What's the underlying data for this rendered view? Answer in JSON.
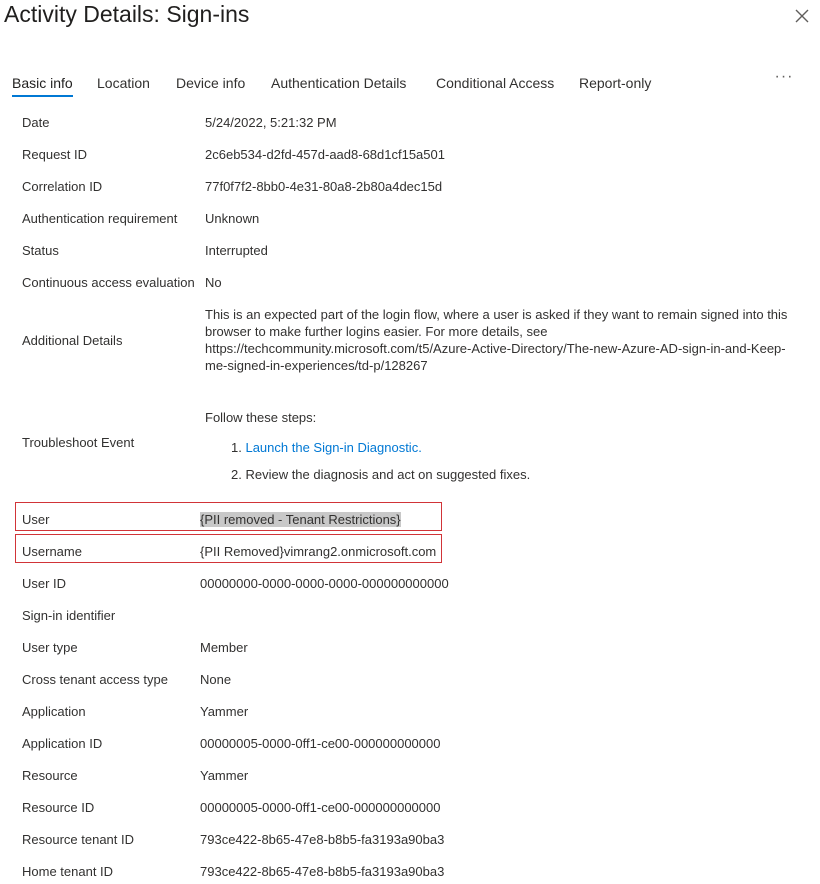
{
  "header": {
    "title": "Activity Details: Sign-ins"
  },
  "tabs": [
    {
      "label": "Basic info"
    },
    {
      "label": "Location"
    },
    {
      "label": "Device info"
    },
    {
      "label": "Authentication Details"
    },
    {
      "label": "Conditional Access"
    },
    {
      "label": "Report-only"
    }
  ],
  "more_label": "···",
  "details": {
    "date": {
      "label": "Date",
      "value": "5/24/2022, 5:21:32 PM"
    },
    "request_id": {
      "label": "Request ID",
      "value": "2c6eb534-d2fd-457d-aad8-68d1cf15a501"
    },
    "correlation_id": {
      "label": "Correlation ID",
      "value": "77f0f7f2-8bb0-4e31-80a8-2b80a4dec15d"
    },
    "auth_requirement": {
      "label": "Authentication requirement",
      "value": "Unknown"
    },
    "status": {
      "label": "Status",
      "value": "Interrupted"
    },
    "cae": {
      "label": "Continuous access evaluation",
      "value": "No"
    },
    "additional_details": {
      "label": "Additional Details",
      "value": "This is an expected part of the login flow, where a user is asked if they want to remain signed into this browser to make further logins easier. For more details, see https://techcommunity.microsoft.com/t5/Azure-Active-Directory/The-new-Azure-AD-sign-in-and-Keep-me-signed-in-experiences/td-p/128267"
    },
    "troubleshoot": {
      "label": "Troubleshoot Event",
      "intro": "Follow these steps:",
      "step1_num": "1.",
      "step1_link": "Launch the Sign-in Diagnostic.",
      "step2": "2. Review the diagnosis and act on suggested fixes."
    },
    "user": {
      "label": "User",
      "value": "{PII removed - Tenant Restrictions}"
    },
    "username": {
      "label": "Username",
      "value": "{PII Removed}vimrang2.onmicrosoft.com"
    },
    "user_id": {
      "label": "User ID",
      "value": "00000000-0000-0000-0000-000000000000"
    },
    "signin_identifier": {
      "label": "Sign-in identifier",
      "value": ""
    },
    "user_type": {
      "label": "User type",
      "value": "Member"
    },
    "cross_tenant": {
      "label": "Cross tenant access type",
      "value": "None"
    },
    "application": {
      "label": "Application",
      "value": "Yammer"
    },
    "application_id": {
      "label": "Application ID",
      "value": "00000005-0000-0ff1-ce00-000000000000"
    },
    "resource": {
      "label": "Resource",
      "value": "Yammer"
    },
    "resource_id": {
      "label": "Resource ID",
      "value": "00000005-0000-0ff1-ce00-000000000000"
    },
    "resource_tenant_id": {
      "label": "Resource tenant ID",
      "value": "793ce422-8b65-47e8-b8b5-fa3193a90ba3"
    },
    "home_tenant_id": {
      "label": "Home tenant ID",
      "value": "793ce422-8b65-47e8-b8b5-fa3193a90ba3"
    }
  },
  "colors": {
    "accent": "#0078d4",
    "highlight_border": "#d13438",
    "text": "#323130"
  },
  "icons": {
    "close": "close-icon",
    "more": "more-horizontal-icon"
  }
}
